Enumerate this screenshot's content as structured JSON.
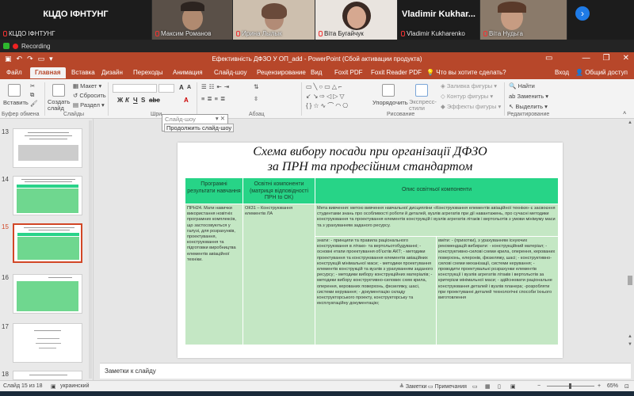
{
  "meeting": {
    "participants": [
      {
        "big_name": "КЦДО ІФНТУНГ",
        "caption": "КЦДО ІФНТУНГ"
      },
      {
        "big_name": "",
        "caption": "Максим Романов"
      },
      {
        "big_name": "",
        "caption": "Ирина Лылык"
      },
      {
        "big_name": "",
        "caption": "Віта Бугайчук"
      },
      {
        "big_name": "Vladimir Kukhar...",
        "caption": "Vladimir Kukharenko"
      },
      {
        "big_name": "",
        "caption": "Віта Нудьга"
      }
    ],
    "next_icon": "chevron-right-icon",
    "recording_label": "Recording"
  },
  "app": {
    "title": "Ефективність ДФЗО У ОП_add - PowerPoint (Сбой активации продукта)",
    "window_controls": [
      "—",
      "❐",
      "✕"
    ],
    "tabs": [
      "Файл",
      "Главная",
      "Вставка",
      "Дизайн",
      "Переходы",
      "Анимация",
      "Слайд-шоу",
      "Рецензирование",
      "Вид",
      "Foxit PDF",
      "Foxit Reader PDF"
    ],
    "active_tab": "Главная",
    "tell_me": "Что вы хотите сделать?",
    "sign_in": "Вход",
    "share": "Общий доступ"
  },
  "ribbon": {
    "paste": "Вставить",
    "new_slide": "Создать слайд",
    "layout": "Макет",
    "reset": "Сбросить",
    "section": "Раздел",
    "groups": {
      "clipboard": "Буфер обмена",
      "slides": "Слайды",
      "font": "Шри",
      "paragraph": "Абзац",
      "drawing": "Рисование",
      "editing": "Редактирование"
    },
    "arrange": "Упорядочить",
    "quick_styles": "Экспресс-стили",
    "shape_fill": "Заливка фигуры",
    "shape_outline": "Контур фигуры",
    "shape_effects": "Эффекты фигуры",
    "find": "Найти",
    "replace": "Заменить",
    "select": "Выделить",
    "tooltip_title": "Слайд-шоу",
    "tooltip_button": "Продолжить слайд-шоу"
  },
  "thumbnails": {
    "numbers": [
      "13",
      "14",
      "15",
      "16",
      "17",
      "18"
    ],
    "selected": "15"
  },
  "slide": {
    "title_line1": "Схема вибору посади при організації ДФЗО",
    "title_line2": "за ПРН та професійним стандартом",
    "col1_header": "Програмні результати навчання",
    "col2_header": "Освітні компоненти (матриця відповідності ПРН to ОК)",
    "col3_header": "Опис освітньої компоненти",
    "col1_body": "ПРН24. Мати навички використання новітніх програмних комплексів, що застосовуються у галузі, для розрахунків, проектування, конструювання та підготовки виробництва елементів авіаційної техніки.",
    "col2_body": "ОК31 – Конструювання елементів ЛА",
    "col3_top": "Мета вивчення: метою вивчення навчальної дисципліни «Конструювання елементів авіаційної техніки» є засвоєння студентами знань про особливості роботи й деталей, вузлів агрегатів при дії навантажень, про сучасні методики конструювання та проектування елементів конструкцій і вузлів агрегатів літаків і вертольотів з умови мінімуму маси та з урахуванням заданого ресурсу.",
    "col3_left": "знати: - принципи та правила раціонального конструювання в літако- та вертольотобудуванні; - основні етапи проектування об'єктів АКТ; - методики проектування та конструювання елементів авіаційних конструкцій мінімальної маси; - методики проектування елементів конструкцій та вузлів з урахуванням заданого ресурсу; - методики вибору конструкційних матеріалів; - методики вибору конструктивно-силових схем крила, оперення, керованих поверхонь, фюзеляжу, шасі, системи керування; - документацію складу конструкторського проекту, конструкторську та експлуатаційну документацію;",
    "col3_right": "вміти: - (прихотки), з урахуванням існуючих рекомендацій вибирати: - конструкційний матеріал; - конструктивно-силові схеми крила, оперення, керованих поверхонь, елеронів, фюзеляжу, шасі; - конструктивно-силові схеми механізації, системи керування; - проводити проектувальні розрахунки елементів конструкції і вузлів агрегатів літаків і вертольотів за критерієм мінімальної маси; - здійснювати раціональне конструювання деталей і вузлів планера; -розробляти при проектуванні деталей технологічні способи їхнього виготовлення"
  },
  "notes_placeholder": "Заметки к слайду",
  "status": {
    "slide_count": "Слайд 15 из 18",
    "language": "украинский",
    "notes": "Заметки",
    "comments": "Примечания",
    "zoom": "65%"
  }
}
